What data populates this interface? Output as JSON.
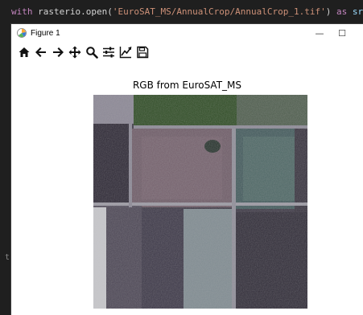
{
  "code": {
    "keyword_with": "with",
    "func": "rasterio.open(",
    "path": "'EuroSAT_MS/AnnualCrop/AnnualCrop_1.tif'",
    "close": ")",
    "keyword_as": "as",
    "var": "src:"
  },
  "gutter": {
    "mark": "t"
  },
  "window": {
    "title": "Figure 1",
    "controls": {
      "minimize": "—",
      "maximize": "☐"
    }
  },
  "toolbar": {
    "icons": [
      "home-icon",
      "back-icon",
      "forward-icon",
      "pan-icon",
      "zoom-icon",
      "configure-subplots-icon",
      "edit-axis-icon",
      "save-icon"
    ]
  },
  "plot": {
    "title": "RGB from EuroSAT_MS"
  },
  "colors": {
    "code_bg": "#1f1f1f",
    "keyword": "#c586c0",
    "string": "#ce9178",
    "window_bg": "#ffffff"
  }
}
